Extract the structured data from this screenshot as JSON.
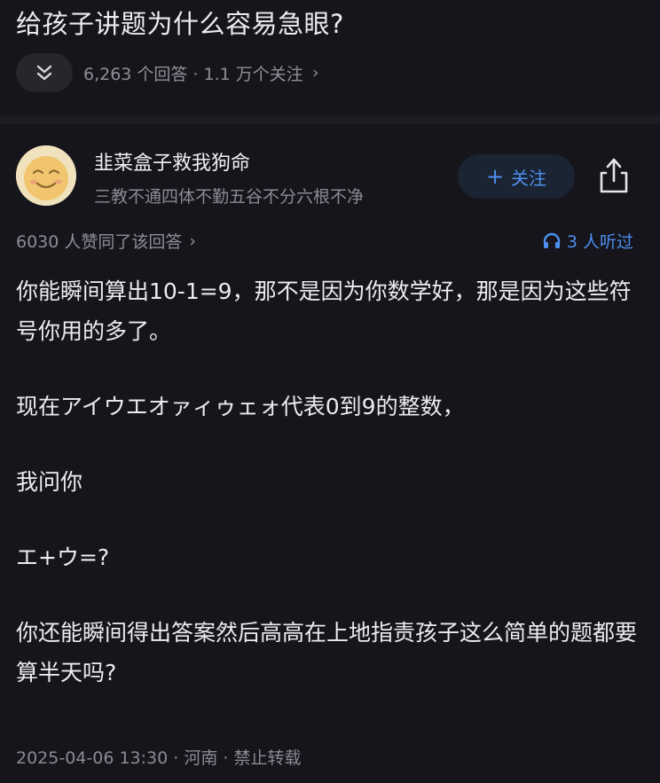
{
  "question": {
    "title": "给孩子讲题为什么容易急眼?",
    "stats": "6,263 个回答 · 1.1 万个关注",
    "collapse_icon": "double-chevron-down",
    "stats_chevron": "›"
  },
  "author": {
    "name": "韭菜盒子救我狗命",
    "bio": "三教不通四体不勤五谷不分六根不净",
    "follow_plus": "+",
    "follow_label": "关注",
    "share_icon": "share"
  },
  "answer_meta": {
    "likes": "6030 人赞同了该回答",
    "likes_chevron": "›",
    "listeners": "3 人听过",
    "listen_icon": "headphones"
  },
  "answer": {
    "paragraphs": [
      "你能瞬间算出10-1=9，那不是因为你数学好，那是因为这些符号你用的多了。",
      "现在アイウエオァィゥェォ代表0到9的整数，",
      "我问你",
      "エ+ウ=?",
      "你还能瞬间得出答案然后高高在上地指责孩子这么简单的题都要算半天吗?"
    ]
  },
  "footer": {
    "text": "2025-04-06 13:30 · 河南 · 禁止转载"
  },
  "colors": {
    "background": "#15151b",
    "accent": "#4d8ff0",
    "follow_bg": "#1b2433",
    "muted_text": "#8a8a93"
  }
}
